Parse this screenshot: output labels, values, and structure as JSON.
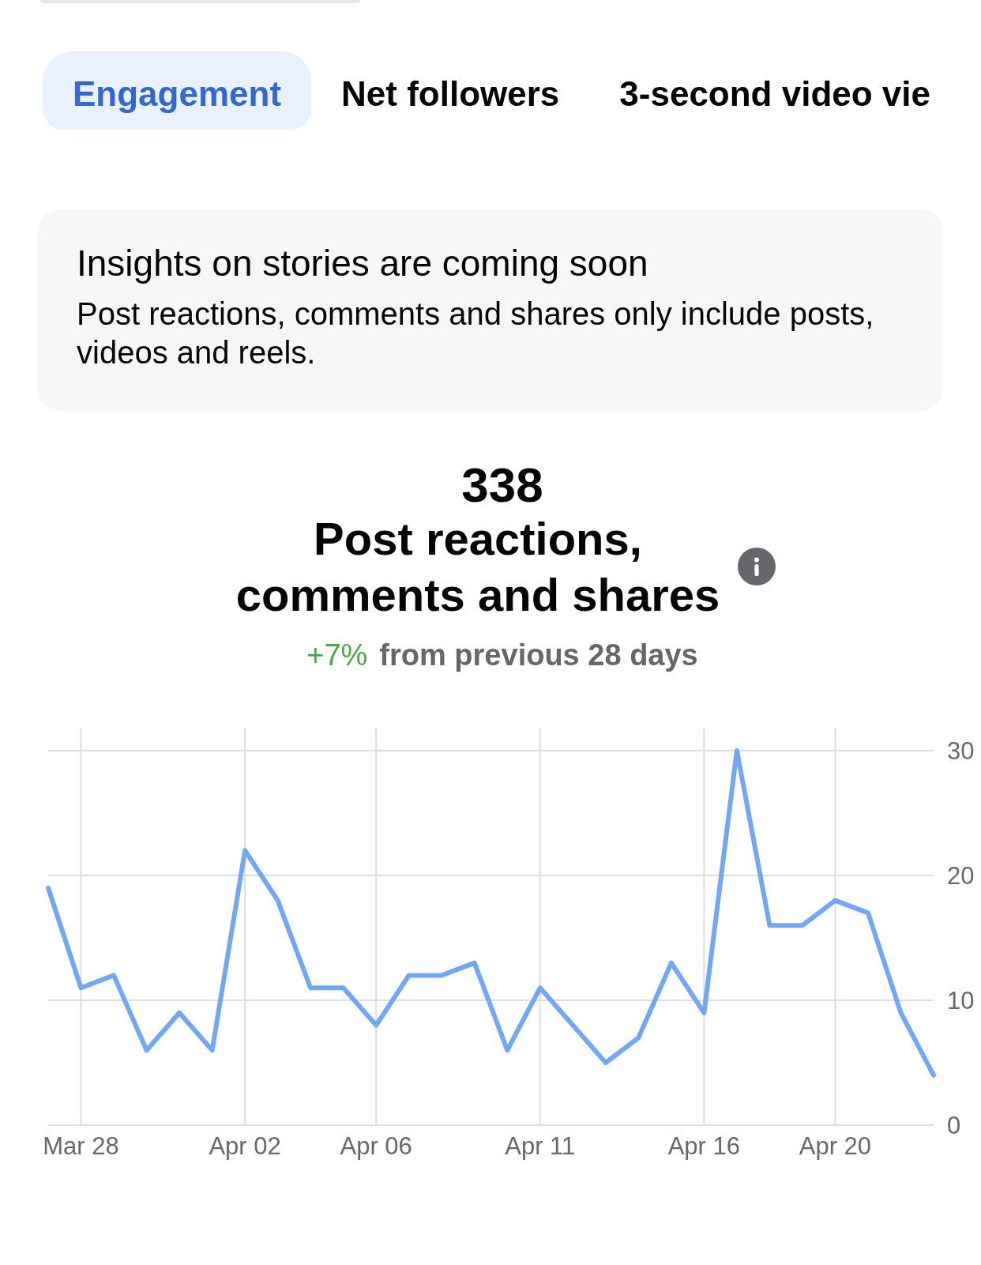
{
  "tabs": [
    {
      "label": "Engagement",
      "selected": true
    },
    {
      "label": "Net followers",
      "selected": false
    },
    {
      "label": "3-second video vie",
      "selected": false
    }
  ],
  "notice": {
    "title": "Insights on stories are coming soon",
    "body": "Post reactions, comments and shares only include posts, videos and reels."
  },
  "summary": {
    "value": "338",
    "label": "Post reactions, comments and shares",
    "change": "+7%",
    "comparison": "from previous 28 days"
  },
  "chart": {
    "chart_data": {
      "type": "line",
      "categories": [
        null,
        "Mar 28",
        null,
        null,
        null,
        null,
        "Apr 02",
        null,
        null,
        null,
        "Apr 06",
        null,
        null,
        null,
        null,
        "Apr 11",
        null,
        null,
        null,
        null,
        "Apr 16",
        null,
        null,
        null,
        "Apr 20",
        null,
        null,
        null
      ],
      "values": [
        19,
        11,
        12,
        6,
        9,
        6,
        22,
        18,
        11,
        11,
        8,
        12,
        12,
        13,
        6,
        11,
        8,
        5,
        7,
        13,
        9,
        30,
        16,
        16,
        18,
        17,
        9,
        4
      ],
      "ylim": [
        0,
        30
      ],
      "yticks": [
        0,
        10,
        20,
        30
      ],
      "grid": true
    }
  }
}
